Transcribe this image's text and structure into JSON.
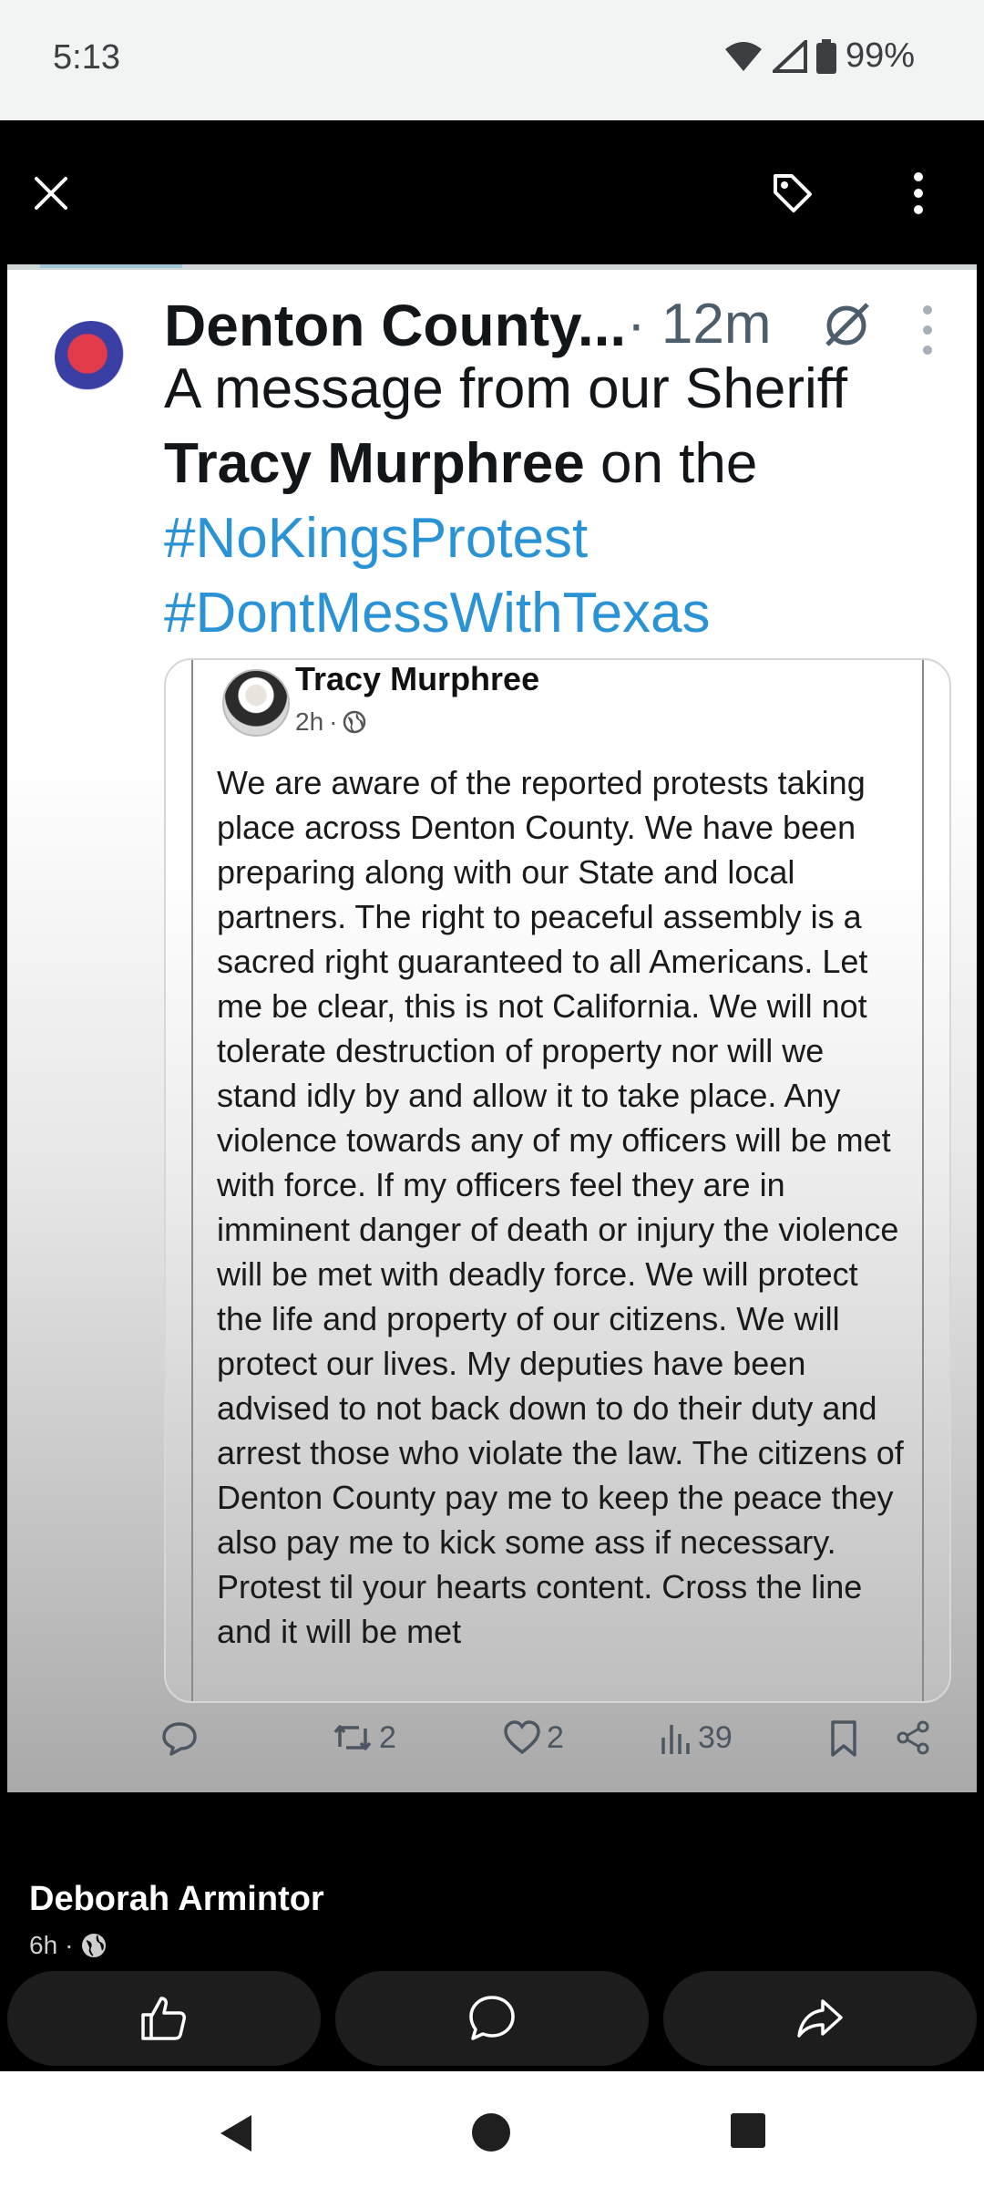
{
  "status": {
    "time": "5:13",
    "battery": "99%"
  },
  "toolbar": {
    "close_icon": "close-icon",
    "tag_icon": "tag-icon",
    "more_icon": "more-vertical-icon"
  },
  "post": {
    "author": "Denton County...",
    "separator": "·",
    "time": "12m",
    "text_line1": "A message from our Sheriff",
    "text_bold": "Tracy Murphree",
    "text_after": " on the",
    "hashtag1": "#NoKingsProtest",
    "hashtag2": "#DontMessWithTexas",
    "embed": {
      "name": "Tracy Murphree",
      "meta_time": "2h",
      "meta_separator": "·",
      "body": "We are aware of the reported protests taking place across Denton County. We have been preparing along with our State and local partners.  The right to peaceful assembly is a sacred right guaranteed to all Americans.  Let me be clear, this is not California.  We will not tolerate destruction of property nor will we stand idly by and allow it to take place.  Any violence towards any of my officers will be met with force. If my officers feel they are in imminent danger of death or injury the violence will be met with deadly force.  We will protect the life and property of our citizens.  We will protect our lives.  My deputies have been advised to not back down to do their duty and arrest those who violate the law.  The citizens of Denton County pay me to keep the peace they also pay me to kick some ass if necessary.  Protest til your hearts content. Cross the line and it will be met"
    },
    "actions": {
      "reposts": "2",
      "likes": "2",
      "views": "39"
    }
  },
  "fb": {
    "author": "Deborah Armintor",
    "time": "6h",
    "separator": "·"
  }
}
